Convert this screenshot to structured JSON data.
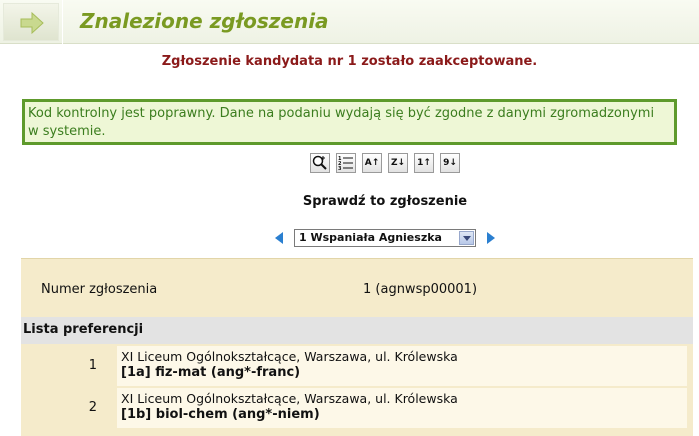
{
  "header": {
    "title": "Znalezione zgłoszenia"
  },
  "messages": {
    "accepted": "Zgłoszenie kandydata nr 1 zostało zaakceptowane.",
    "check_ok": "Kod kontrolny jest poprawny. Dane na podaniu wydają się być zgodne z danymi zgromadzonymi w systemie."
  },
  "toolbar": {
    "buttons": [
      {
        "icon": "zoom-icon",
        "label": ""
      },
      {
        "icon": "numbered-list-icon",
        "label": ""
      },
      {
        "icon": "sort-alpha-asc-icon",
        "label": "A↑"
      },
      {
        "icon": "sort-alpha-desc-icon",
        "label": "Z↓"
      },
      {
        "icon": "sort-num-asc-icon",
        "label": "1↑"
      },
      {
        "icon": "sort-num-desc-icon",
        "label": "9↓"
      }
    ]
  },
  "check": {
    "title": "Sprawdź to zgłoszenie",
    "selected": "1 Wspaniała Agnieszka"
  },
  "details": {
    "number_label": "Numer zgłoszenia",
    "number_value": "1 (agnwsp00001)",
    "preferences_title": "Lista preferencji",
    "preferences": [
      {
        "num": "1",
        "school": "XI Liceum Ogólnokształcące, Warszawa, ul. Królewska",
        "class": "[1a] fiz-mat (ang*-franc)"
      },
      {
        "num": "2",
        "school": "XI Liceum Ogólnokształcące, Warszawa, ul. Królewska",
        "class": "[1b] biol-chem (ang*-niem)"
      }
    ]
  },
  "colors": {
    "accent": "#7a9a22",
    "ok_border": "#5e9a2c",
    "ok_text": "#3b7d1e",
    "error_text": "#8b1a1a"
  }
}
